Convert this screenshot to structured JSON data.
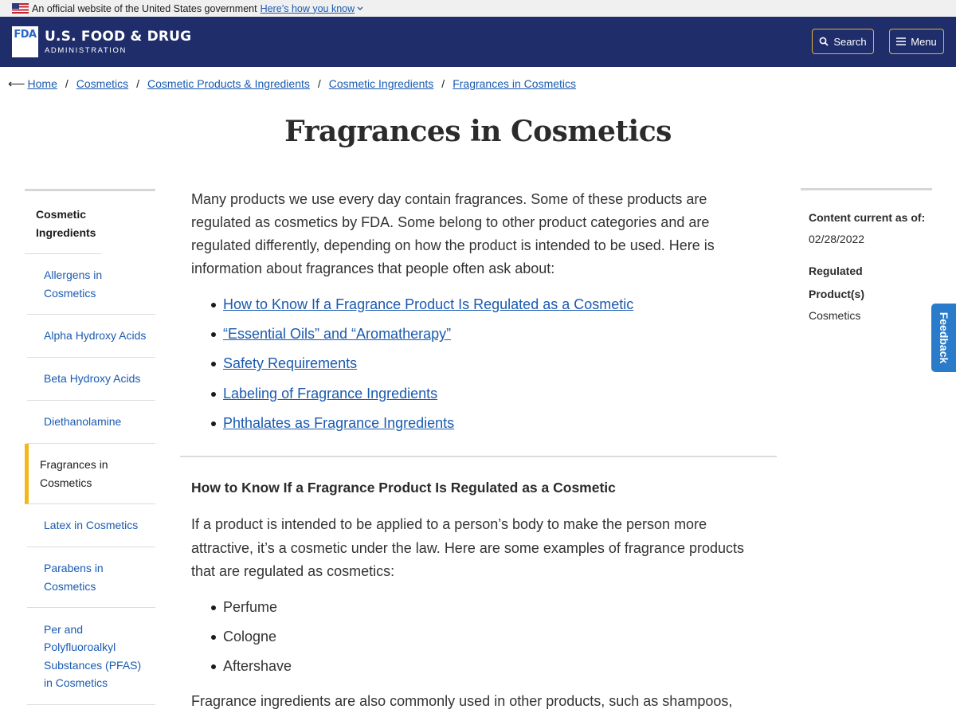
{
  "gov_banner": {
    "text": "An official website of the United States government",
    "link": "Here’s how you know"
  },
  "header": {
    "logo_text": "FDA",
    "agency_line1": "U.S. FOOD & DRUG",
    "agency_line2": "ADMINISTRATION",
    "search_label": "Search",
    "menu_label": "Menu"
  },
  "breadcrumb": [
    "Home",
    "Cosmetics",
    "Cosmetic Products & Ingredients",
    "Cosmetic Ingredients",
    "Fragrances in Cosmetics"
  ],
  "page_title": "Fragrances in Cosmetics",
  "sidebar": {
    "heading": "Cosmetic Ingredients",
    "items": [
      {
        "label": "Allergens in Cosmetics",
        "active": false
      },
      {
        "label": "Alpha Hydroxy Acids",
        "active": false
      },
      {
        "label": "Beta Hydroxy Acids",
        "active": false
      },
      {
        "label": "Diethanolamine",
        "active": false
      },
      {
        "label": "Fragrances in Cosmetics",
        "active": true
      },
      {
        "label": "Latex in Cosmetics",
        "active": false
      },
      {
        "label": "Parabens in Cosmetics",
        "active": false
      },
      {
        "label": "Per and Polyfluoroalkyl Substances (PFAS) in Cosmetics",
        "active": false
      }
    ]
  },
  "main": {
    "intro": "Many products we use every day contain fragrances. Some of these products are regulated as cosmetics by FDA. Some belong to other product categories and are regulated differently, depending on how the product is intended to be used. Here is information about fragrances that people often ask about:",
    "links": [
      "How to Know If a Fragrance Product Is Regulated as a Cosmetic",
      "“Essential Oils” and “Aromatherapy”",
      "Safety Requirements",
      "Labeling of Fragrance Ingredients",
      "Phthalates as Fragrance Ingredients"
    ],
    "section_title": "How to Know If a Fragrance Product Is Regulated as a Cosmetic",
    "section_para": "If a product is intended to be applied to a person’s body to make the person more attractive, it’s a cosmetic under the law. Here are some examples of fragrance products that are regulated as cosmetics:",
    "examples": [
      "Perfume",
      "Cologne",
      "Aftershave"
    ],
    "more_text": "Fragrance ingredients are also commonly used in other products, such as shampoos,"
  },
  "meta": {
    "content_label": "Content current as of:",
    "content_date": "02/28/2022",
    "regulated_label": "Regulated Product(s)",
    "regulated_value": "Cosmetics"
  },
  "feedback_label": "Feedback",
  "colors": {
    "header_bg": "#1f2d6b",
    "accent_gold": "#e0b33b",
    "link_blue": "#1a5ab0",
    "active_bar": "#f0b918",
    "feedback_bg": "#2a7bc9"
  }
}
